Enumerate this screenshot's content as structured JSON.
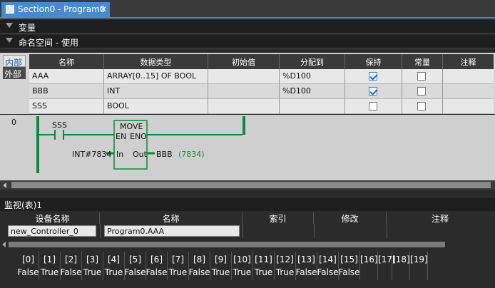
{
  "tab": {
    "title": "Section0 - Program0",
    "close": "✕"
  },
  "sections": {
    "variables": "变量",
    "namespace": "命名空间 - 使用"
  },
  "scope_tabs": {
    "internal": "内部",
    "external": "外部"
  },
  "var_table": {
    "headers": [
      "名称",
      "数据类型",
      "初始值",
      "分配到",
      "保持",
      "常量",
      "注释"
    ],
    "rows": [
      {
        "name": "AAA",
        "type": "ARRAY[0..15] OF BOOL",
        "init": "",
        "at": "%D100",
        "retain": true,
        "constant": false,
        "comment": ""
      },
      {
        "name": "BBB",
        "type": "INT",
        "init": "",
        "at": "%D100",
        "retain": true,
        "constant": false,
        "comment": ""
      },
      {
        "name": "SSS",
        "type": "BOOL",
        "init": "",
        "at": "",
        "retain": false,
        "constant": false,
        "comment": ""
      }
    ]
  },
  "ladder": {
    "rung": "0",
    "contact": "SSS",
    "fb_name": "MOVE",
    "en": "EN",
    "eno": "ENO",
    "in_label": "In",
    "out_label": "Out",
    "in_value": "INT#7834",
    "out_var": "BBB",
    "out_monitor": "(7834)",
    "wire_color": "#0a8a3a"
  },
  "watch": {
    "title": "监视(表)1",
    "headers": [
      "设备名称",
      "名称",
      "索引",
      "修改",
      "注释"
    ],
    "device": "new_Controller_0",
    "name": "Program0.AAA",
    "bits": [
      {
        "idx": "[0]",
        "val": "False"
      },
      {
        "idx": "[1]",
        "val": "True"
      },
      {
        "idx": "[2]",
        "val": "False"
      },
      {
        "idx": "[3]",
        "val": "True"
      },
      {
        "idx": "[4]",
        "val": "True"
      },
      {
        "idx": "[5]",
        "val": "False"
      },
      {
        "idx": "[6]",
        "val": "False"
      },
      {
        "idx": "[7]",
        "val": "True"
      },
      {
        "idx": "[8]",
        "val": "False"
      },
      {
        "idx": "[9]",
        "val": "True"
      },
      {
        "idx": "[10]",
        "val": "True"
      },
      {
        "idx": "[11]",
        "val": "True"
      },
      {
        "idx": "[12]",
        "val": "True"
      },
      {
        "idx": "[13]",
        "val": "False"
      },
      {
        "idx": "[14]",
        "val": "False"
      },
      {
        "idx": "[15]",
        "val": "False"
      },
      {
        "idx": "[16]",
        "val": ""
      },
      {
        "idx": "[17]",
        "val": ""
      },
      {
        "idx": "[18]",
        "val": ""
      },
      {
        "idx": "[19]",
        "val": ""
      }
    ]
  }
}
